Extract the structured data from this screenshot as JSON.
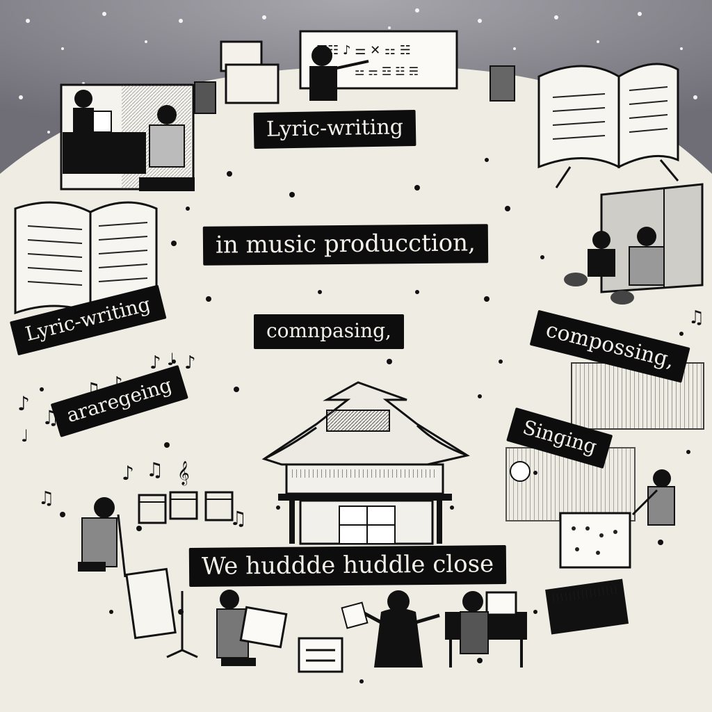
{
  "colors": {
    "paper": "#efece4",
    "sky": "#8c8a92",
    "ink": "#0d0d0d",
    "banner_text": "#f3f1ea"
  },
  "labels": {
    "lyric_top": "Lyric-writing",
    "production": "in music producction,",
    "lyric_left": "Lyric-writing",
    "composing_center": "comnpasing,",
    "composing_right": "compossing,",
    "arranging": "araregeing",
    "singing": "Singing",
    "huddle": "We huddde huddle close"
  },
  "scene_elements": [
    "snowy-sky",
    "pagoda-building-icon",
    "open-book-icon",
    "piano-icon",
    "flute-player-icon",
    "conductor-icon",
    "music-stand-icon",
    "music-note-icon"
  ]
}
